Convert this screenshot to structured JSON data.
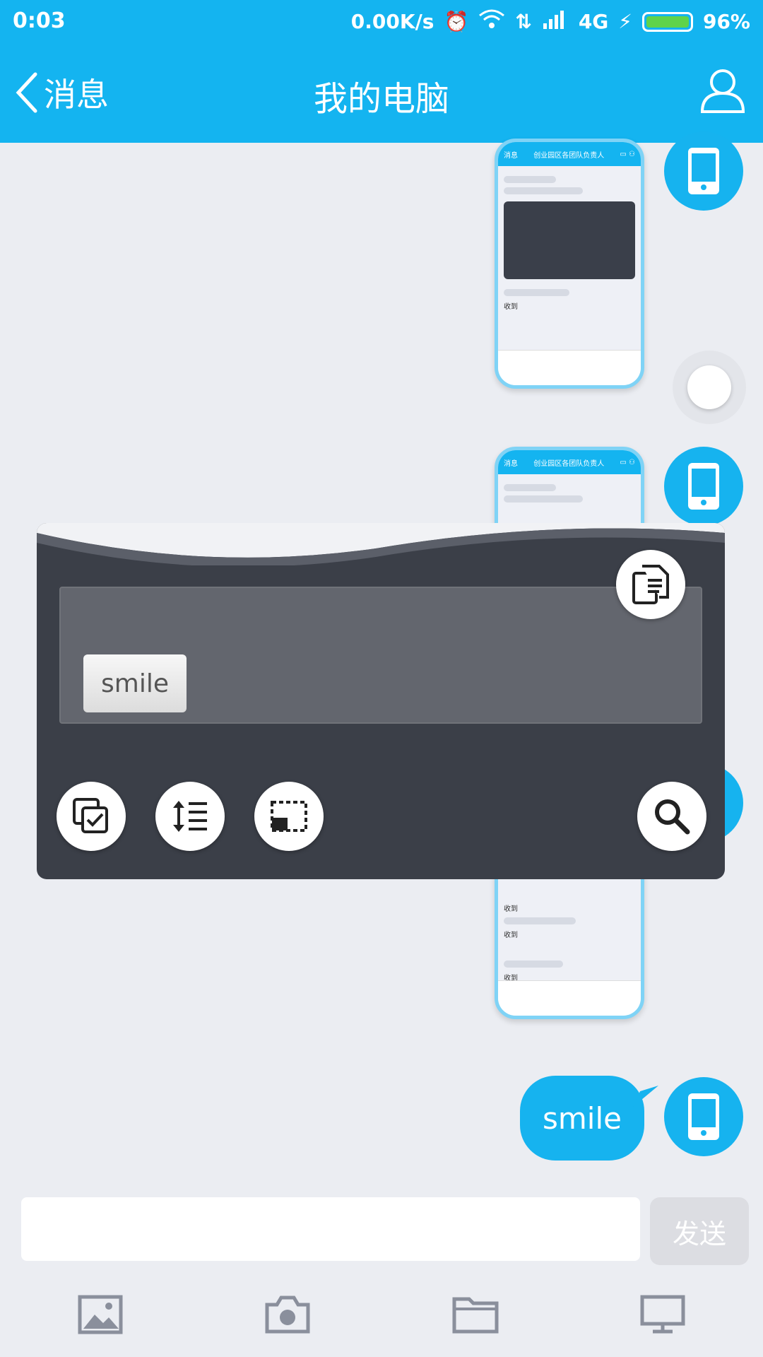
{
  "status_bar": {
    "time": "0:03",
    "net_speed": "0.00K/s",
    "network": "4G",
    "battery": "96%"
  },
  "header": {
    "back_label": "消息",
    "title": "我的电脑"
  },
  "screenshot_preview": {
    "header_left": "消息",
    "header_title": "创业园区各团队负责人",
    "reply_text": "收到"
  },
  "overlay": {
    "chip_label": "smile"
  },
  "messages": {
    "last_text": "smile"
  },
  "composer": {
    "input_value": "",
    "send_label": "发送"
  },
  "colors": {
    "brand": "#14b4f0",
    "panel": "#3b3f48",
    "background": "#ebedf2"
  }
}
